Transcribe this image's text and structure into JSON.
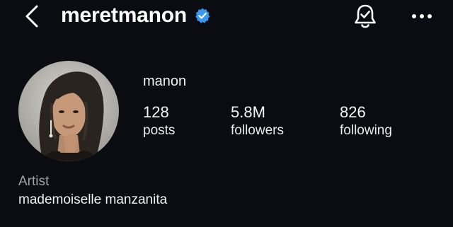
{
  "header": {
    "username": "meretmanon",
    "back_icon": "chevron-left-icon",
    "verified_icon": "verified-badge-icon",
    "verified_color": "#3897f0",
    "notification_icon": "bell-check-icon",
    "more_icon": "ellipsis-icon"
  },
  "profile": {
    "display_name": "manon",
    "stats": [
      {
        "value": "128",
        "label": "posts"
      },
      {
        "value": "5.8M",
        "label": "followers"
      },
      {
        "value": "826",
        "label": "following"
      }
    ],
    "category": "Artist",
    "bio": "mademoiselle manzanita"
  }
}
